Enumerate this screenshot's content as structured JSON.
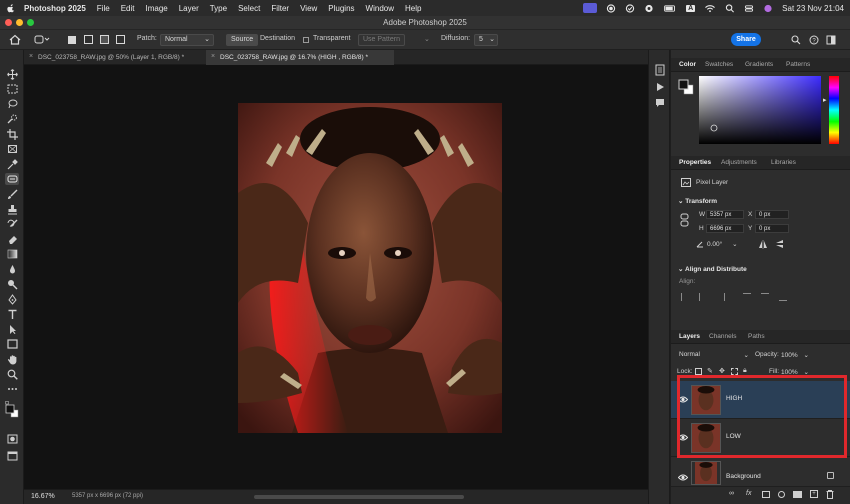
{
  "menubar": {
    "app_name": "Photoshop 2025",
    "menus": [
      "File",
      "Edit",
      "Image",
      "Layer",
      "Type",
      "Select",
      "Filter",
      "View",
      "Plugins",
      "Window",
      "Help"
    ],
    "clock": "Sat 23 Nov  21:04",
    "status_letter": "A"
  },
  "window": {
    "title": "Adobe Photoshop 2025"
  },
  "options": {
    "patch_label": "Patch:",
    "patch_value": "Normal",
    "source": "Source",
    "destination": "Destination",
    "transparent": "Transparent",
    "use_pattern": "Use Pattern",
    "diffusion_label": "Diffusion:",
    "diffusion_value": "5",
    "share": "Share"
  },
  "tabs": [
    {
      "label": "DSC_023758_RAW.jpg @ 50% (Layer 1, RGB/8) *",
      "active": false
    },
    {
      "label": "DSC_023758_RAW.jpg @ 16.7% (HIGH , RGB/8) *",
      "active": true
    }
  ],
  "status": {
    "zoom": "16.67%",
    "dimensions": "5357 px x 6696 px (72 ppi)"
  },
  "color_panel": {
    "tabs": [
      "Color",
      "Swatches",
      "Gradients",
      "Patterns"
    ]
  },
  "properties_panel": {
    "tabs": [
      "Properties",
      "Adjustments",
      "Libraries"
    ],
    "layer_type": "Pixel Layer",
    "transform_title": "Transform",
    "w_label": "W",
    "w_value": "5357 px",
    "h_label": "H",
    "h_value": "6696 px",
    "x_label": "X",
    "x_value": "0 px",
    "y_label": "Y",
    "y_value": "0 px",
    "angle": "0.00°",
    "align_title": "Align and Distribute",
    "align_label": "Align:"
  },
  "layers_panel": {
    "tabs": [
      "Layers",
      "Channels",
      "Paths"
    ],
    "blend_mode": "Normal",
    "opacity_label": "Opacity:",
    "opacity_value": "100%",
    "lock_label": "Lock:",
    "fill_label": "Fill:",
    "fill_value": "100%",
    "layers": [
      {
        "name": "HIGH",
        "selected": true
      },
      {
        "name": "LOW",
        "selected": false
      },
      {
        "name": "Background",
        "selected": false
      }
    ]
  },
  "colors": {
    "accent": "#1473e6",
    "highlight": "#e0282c",
    "selected_layer": "#2a3f56",
    "traffic_red": "#ff5f57",
    "traffic_yellow": "#febc2e",
    "traffic_green": "#28c840"
  }
}
